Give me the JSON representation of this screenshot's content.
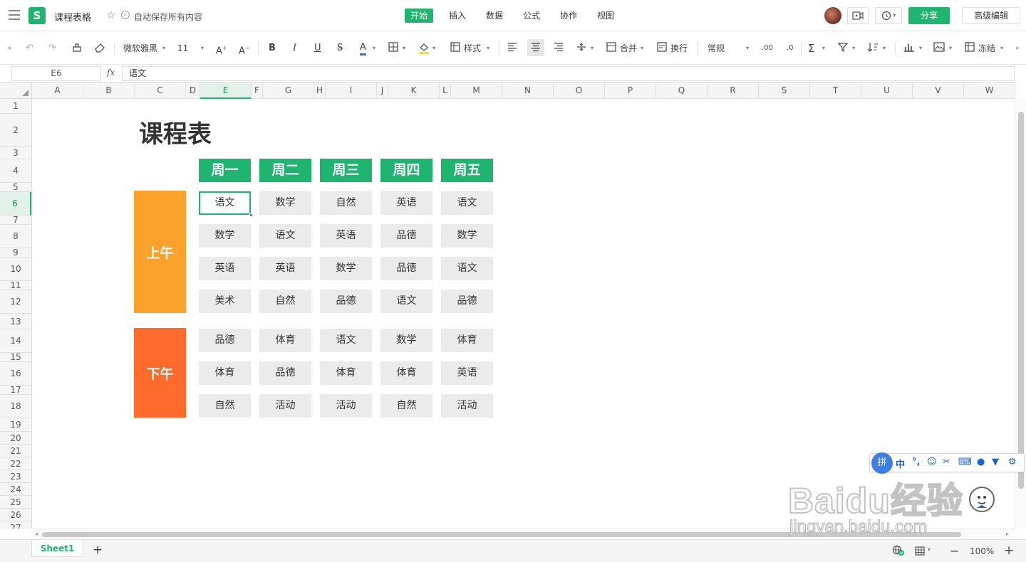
{
  "topbar": {
    "doc_title": "课程表格",
    "save_status": "自动保存所有内容",
    "tabs": [
      "开始",
      "插入",
      "数据",
      "公式",
      "协作",
      "视图"
    ],
    "share_label": "分享",
    "advanced_label": "高级编辑",
    "logo_letter": "S"
  },
  "toolbar": {
    "font_family": "微软雅黑",
    "font_size": "11",
    "style_label": "样式",
    "merge_label": "合并",
    "wrap_label": "换行",
    "number_format": "常规",
    "freeze_label": "冻结",
    "icons": [
      "undo-icon",
      "redo-icon",
      "format-painter-icon",
      "eraser-icon",
      "increase-font-icon",
      "decrease-font-icon",
      "bold-icon",
      "italic-icon",
      "underline-icon",
      "strikethrough-icon",
      "font-color-icon",
      "border-icon",
      "fill-color-icon",
      "align-left-icon",
      "align-center-icon",
      "align-right-icon",
      "vertical-align-icon",
      "decimal-increase-icon",
      "decimal-decrease-icon",
      "sum-icon",
      "filter-icon",
      "sort-icon",
      "chart-icon",
      "image-icon"
    ],
    "accent_color": "#1fb46f"
  },
  "formula_bar": {
    "name_box": "E6",
    "fx_label": "fx",
    "formula": "语文"
  },
  "grid": {
    "columns": [
      "A",
      "B",
      "C",
      "D",
      "E",
      "F",
      "G",
      "H",
      "I",
      "J",
      "K",
      "L",
      "M",
      "N",
      "O",
      "P",
      "Q",
      "R",
      "S",
      "T",
      "U",
      "V",
      "W"
    ],
    "active_column": "E",
    "rows": [
      "1",
      "2",
      "3",
      "4",
      "5",
      "6",
      "7",
      "8",
      "9",
      "10",
      "11",
      "12",
      "13",
      "14",
      "15",
      "16",
      "17",
      "18",
      "19",
      "20",
      "21",
      "22",
      "23",
      "24",
      "25",
      "26",
      "27"
    ],
    "active_row": "6"
  },
  "timetable": {
    "title": "课程表",
    "days": [
      "周一",
      "周二",
      "周三",
      "周四",
      "周五"
    ],
    "morning_label": "上午",
    "afternoon_label": "下午",
    "morning": [
      [
        "语文",
        "数学",
        "自然",
        "英语",
        "语文"
      ],
      [
        "数学",
        "语文",
        "英语",
        "品德",
        "数学"
      ],
      [
        "英语",
        "英语",
        "数学",
        "品德",
        "语文"
      ],
      [
        "美术",
        "自然",
        "品德",
        "语文",
        "品德"
      ]
    ],
    "afternoon": [
      [
        "品德",
        "体育",
        "语文",
        "数学",
        "体育"
      ],
      [
        "体育",
        "品德",
        "体育",
        "体育",
        "英语"
      ],
      [
        "自然",
        "活动",
        "活动",
        "自然",
        "活动"
      ]
    ],
    "colors": {
      "header": "#1fb46f",
      "morning": "#fba22d",
      "afternoon": "#ff6a2d",
      "cell": "#ebebeb"
    }
  },
  "bottombar": {
    "sheet_tab": "Sheet1",
    "add_sheet": "+",
    "zoom_level": "100%"
  },
  "ime": {
    "logo": "拼",
    "mode": "中",
    "punct": "°,"
  },
  "watermark": {
    "logo": "Baidu经验",
    "url": "jingyan.baidu.com"
  }
}
